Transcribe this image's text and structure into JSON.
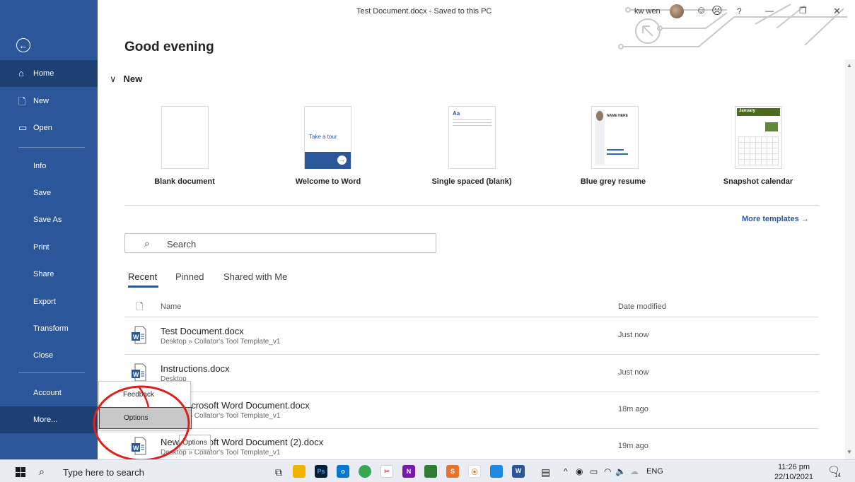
{
  "window": {
    "title": "Test Document.docx  -  Saved to this PC",
    "user": "kw wen",
    "help": "?",
    "minimize": "—",
    "restore": "❐",
    "close": "✕"
  },
  "greeting": "Good evening",
  "sidebar": {
    "back": "←",
    "items": [
      {
        "label": "Home"
      },
      {
        "label": "New"
      },
      {
        "label": "Open"
      },
      {
        "label": "Info"
      },
      {
        "label": "Save"
      },
      {
        "label": "Save As"
      },
      {
        "label": "Print"
      },
      {
        "label": "Share"
      },
      {
        "label": "Export"
      },
      {
        "label": "Transform"
      },
      {
        "label": "Close"
      },
      {
        "label": "Account"
      },
      {
        "label": "More..."
      }
    ]
  },
  "new_section": {
    "header": "New",
    "chevron": "∨",
    "templates": [
      {
        "label": "Blank document"
      },
      {
        "label": "Welcome to Word",
        "thumb_text": "Take a tour"
      },
      {
        "label": "Single spaced (blank)",
        "thumb_text": "Aa"
      },
      {
        "label": "Blue grey resume",
        "thumb_text": "NAME HERE"
      },
      {
        "label": "Snapshot calendar",
        "thumb_text": "January"
      }
    ],
    "more_templates": "More templates  →"
  },
  "search": {
    "placeholder": "Search",
    "icon": "⌕"
  },
  "tabs": {
    "recent": "Recent",
    "pinned": "Pinned",
    "shared": "Shared with Me"
  },
  "columns": {
    "name": "Name",
    "date": "Date modified"
  },
  "files": [
    {
      "name": "Test Document.docx",
      "path": "Desktop » Collator's Tool Template_v1",
      "date": "Just now"
    },
    {
      "name": "Instructions.docx",
      "path": "Desktop",
      "date": "Just now"
    },
    {
      "name": "New Microsoft Word Document.docx",
      "path": "Desktop » Collator's Tool Template_v1",
      "date": "18m ago"
    },
    {
      "name": "New Microsoft Word Document (2).docx",
      "path": "Desktop » Collator's Tool Template_v1",
      "date": "19m ago"
    }
  ],
  "popup": {
    "feedback": "Feedback",
    "options": "Options"
  },
  "tooltip": "Options",
  "taskbar": {
    "search_placeholder": "Type here to search",
    "lang": "ENG",
    "time": "11:26 pm",
    "date": "22/10/2021",
    "notifications": "14"
  },
  "colors": {
    "accent": "#2b579a",
    "sidebar_active": "#1e3f73",
    "annotation": "#e0201c"
  }
}
